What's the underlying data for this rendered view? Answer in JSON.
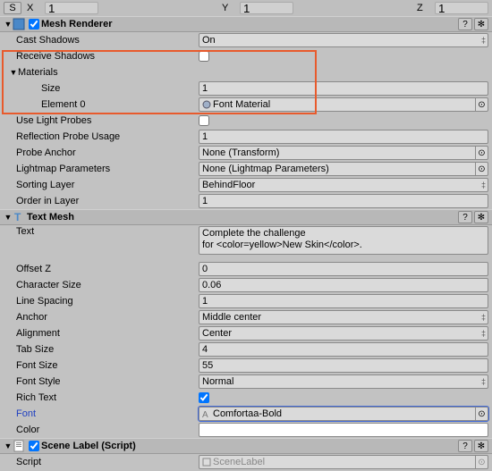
{
  "top": {
    "btn": "S",
    "xl": "X",
    "xv": "1",
    "yl": "Y",
    "yv": "1",
    "zl": "Z",
    "zv": "1"
  },
  "meshRenderer": {
    "title": "Mesh Renderer",
    "castShadows": {
      "label": "Cast Shadows",
      "value": "On"
    },
    "receiveShadows": {
      "label": "Receive Shadows"
    },
    "materials": {
      "label": "Materials",
      "size": {
        "label": "Size",
        "value": "1"
      },
      "element0": {
        "label": "Element 0",
        "value": "Font Material"
      }
    },
    "useLightProbes": {
      "label": "Use Light Probes"
    },
    "reflectionProbeUsage": {
      "label": "Reflection Probe Usage",
      "value": "1"
    },
    "probeAnchor": {
      "label": "Probe Anchor",
      "value": "None (Transform)"
    },
    "lightmapParameters": {
      "label": "Lightmap Parameters",
      "value": "None (Lightmap Parameters)"
    },
    "sortingLayer": {
      "label": "Sorting Layer",
      "value": "BehindFloor"
    },
    "orderInLayer": {
      "label": "Order in Layer",
      "value": "1"
    }
  },
  "textMesh": {
    "title": "Text Mesh",
    "text": {
      "label": "Text",
      "value": "Complete the challenge\nfor <color=yellow>New Skin</color>."
    },
    "offsetZ": {
      "label": "Offset Z",
      "value": "0"
    },
    "characterSize": {
      "label": "Character Size",
      "value": "0.06"
    },
    "lineSpacing": {
      "label": "Line Spacing",
      "value": "1"
    },
    "anchor": {
      "label": "Anchor",
      "value": "Middle center"
    },
    "alignment": {
      "label": "Alignment",
      "value": "Center"
    },
    "tabSize": {
      "label": "Tab Size",
      "value": "4"
    },
    "fontSize": {
      "label": "Font Size",
      "value": "55"
    },
    "fontStyle": {
      "label": "Font Style",
      "value": "Normal"
    },
    "richText": {
      "label": "Rich Text"
    },
    "font": {
      "label": "Font",
      "value": "Comfortaa-Bold"
    },
    "color": {
      "label": "Color"
    }
  },
  "sceneLabel": {
    "title": "Scene Label (Script)",
    "script": {
      "label": "Script",
      "value": "SceneLabel"
    }
  },
  "icons": {
    "help": "?",
    "gear": "✻",
    "picker": "⊙"
  }
}
